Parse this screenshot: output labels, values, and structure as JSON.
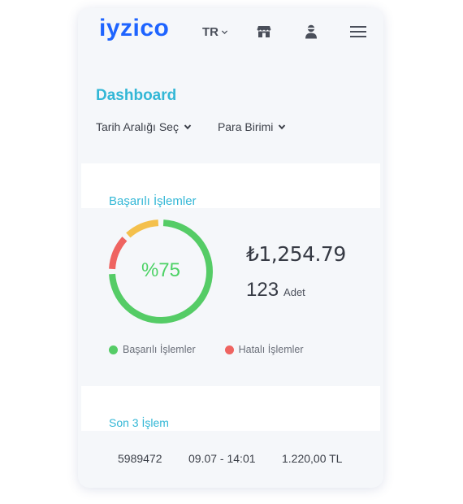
{
  "header": {
    "logo": "iyzico",
    "language": "TR",
    "icons": [
      "store-icon",
      "user-icon",
      "menu-icon"
    ]
  },
  "page": {
    "title": "Dashboard",
    "filters": [
      {
        "label": "Tarih Aralığı Seç"
      },
      {
        "label": "Para Birimi"
      }
    ]
  },
  "summary": {
    "title": "Başarılı İşlemler",
    "percent_label": "%75",
    "success_ratio": 0.75,
    "amount": "₺1,254.79",
    "count": "123",
    "count_unit": "Adet",
    "legend": [
      {
        "label": "Başarılı İşlemler",
        "color": "#55cc66"
      },
      {
        "label": "Hatalı İşlemler",
        "color": "#ef6461"
      }
    ],
    "segment_colors": {
      "success": "#55cc66",
      "error": "#ef6461",
      "pending": "#f4c04c"
    }
  },
  "recent": {
    "title": "Son 3 İşlem",
    "rows": [
      {
        "id": "5989472",
        "date": "09.07 - 14:01",
        "amount": "1.220,00 TL"
      }
    ]
  },
  "colors": {
    "brand": "#1e64ff",
    "accent": "#33b7d6"
  }
}
